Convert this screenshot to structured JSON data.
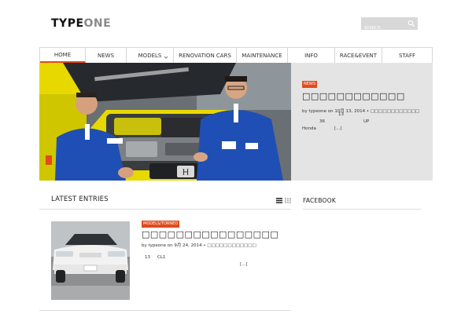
{
  "header": {
    "logo_primary": "TYPE",
    "logo_secondary": "ONE",
    "search_placeholder": "SEARCH"
  },
  "nav": {
    "items": [
      {
        "label": "HOME",
        "active": true
      },
      {
        "label": "NEWS"
      },
      {
        "label": "MODELS",
        "has_submenu": true
      },
      {
        "label": "RENOVATION CARS"
      },
      {
        "label": "MAINTENANCE"
      },
      {
        "label": "INFO"
      },
      {
        "label": "RACE&EVENT"
      },
      {
        "label": "STAFF"
      }
    ]
  },
  "featured": {
    "tag": "NEWS",
    "title": "□□□□□□□□□□□□",
    "meta": "by typeone on 10月 13, 2014 • □□□□□□□□□□□□",
    "excerpt": {
      "line1": "13",
      "line2a": "36",
      "line2b": "UP",
      "line3": "Honda",
      "more": "[...]"
    }
  },
  "latest": {
    "heading": "LATEST ENTRIES",
    "entry": {
      "tag": "MODELS/TORNEO",
      "title": "□□□□□□□□□□□□□□□□",
      "meta": "by typeone on 9月 24, 2014 • □□□□□□□□□□□□",
      "excerpt_a": "13",
      "excerpt_b": "CL1",
      "more": "[...]"
    }
  },
  "sidebar": {
    "heading": "FACEBOOK"
  },
  "colors": {
    "accent": "#e24a1c",
    "jacket": "#1f4fb5",
    "car_yellow": "#e7d900"
  }
}
